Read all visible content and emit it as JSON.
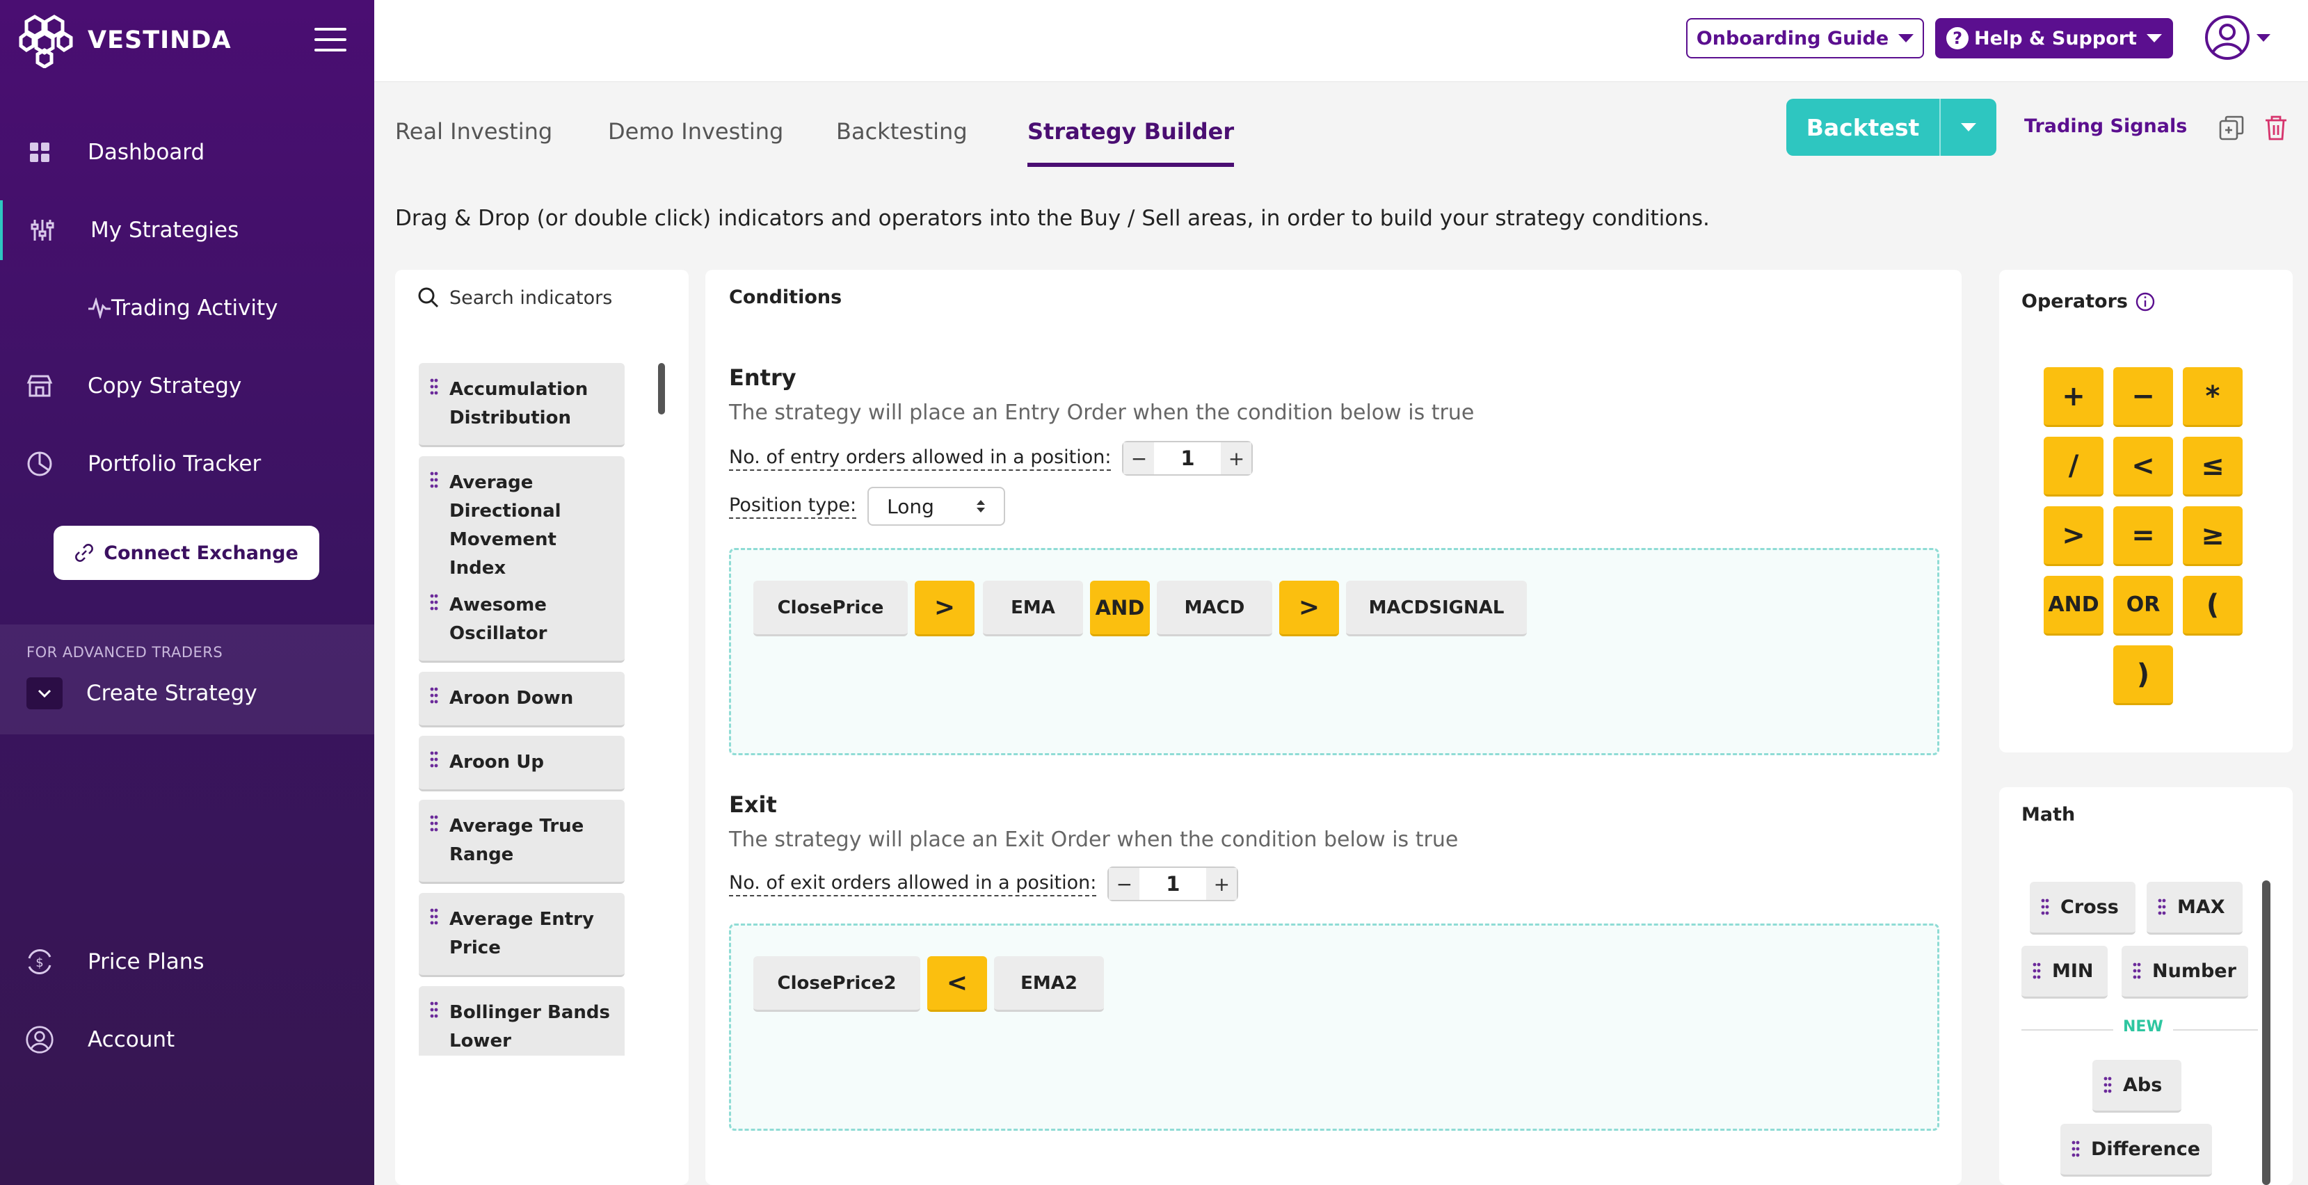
{
  "brand": {
    "name": "VESTINDA"
  },
  "sidebar": {
    "items": [
      {
        "label": "Dashboard",
        "icon": "grid-icon"
      },
      {
        "label": "My Strategies",
        "icon": "sliders-icon"
      },
      {
        "label": "Trading Activity",
        "icon": "pulse-icon"
      },
      {
        "label": "Copy Strategy",
        "icon": "store-icon"
      },
      {
        "label": "Portfolio Tracker",
        "icon": "pie-chart-icon"
      },
      {
        "label": "Price Plans",
        "icon": "dollar-cycle-icon"
      },
      {
        "label": "Account",
        "icon": "user-circle-icon"
      }
    ],
    "connect_label": "Connect Exchange",
    "advanced_label": "FOR ADVANCED TRADERS",
    "create_label": "Create Strategy",
    "accent": "#2ec6c0"
  },
  "topbar": {
    "onboarding_label": "Onboarding Guide",
    "help_label": "Help & Support"
  },
  "tabs": [
    {
      "label": "Real Investing"
    },
    {
      "label": "Demo Investing"
    },
    {
      "label": "Backtesting"
    },
    {
      "label": "Strategy Builder",
      "active": true
    }
  ],
  "actions": {
    "backtest_label": "Backtest",
    "signals_label": "Trading Signals"
  },
  "instruction": "Drag & Drop (or double click) indicators and operators into the Buy / Sell areas, in order to build your strategy conditions.",
  "indicators": {
    "search_placeholder": "Search indicators",
    "items": [
      "Accumulation Distribution",
      "Average Directional Movement Index",
      "Awesome Oscillator",
      "Aroon Down",
      "Aroon Up",
      "Average True Range",
      "Average Entry Price",
      "Bollinger Bands Lower"
    ]
  },
  "conditions": {
    "title": "Conditions",
    "entry": {
      "title": "Entry",
      "description": "The strategy will place an Entry Order when the condition below is true",
      "orders_label": "No. of entry orders allowed in a position:",
      "orders_value": "1",
      "position_label": "Position type:",
      "position_value": "Long",
      "tokens": [
        "ClosePrice",
        ">",
        "EMA",
        "AND",
        "MACD",
        ">",
        "MACDSIGNAL"
      ]
    },
    "exit": {
      "title": "Exit",
      "description": "The strategy will place an Exit Order when the condition below is true",
      "orders_label": "No. of exit orders allowed in a position:",
      "orders_value": "1",
      "tokens": [
        "ClosePrice2",
        "<",
        "EMA2"
      ]
    }
  },
  "operators": {
    "title": "Operators",
    "items": [
      "+",
      "−",
      "*",
      "/",
      "<",
      "≤",
      ">",
      "=",
      "≥",
      "AND",
      "OR",
      "(",
      ")"
    ]
  },
  "math": {
    "title": "Math",
    "items": [
      "Cross",
      "MAX",
      "MIN",
      "Number"
    ],
    "new_label": "NEW",
    "new_items": [
      "Abs",
      "Difference"
    ]
  },
  "colors": {
    "sidebar_bg": "#4a0e72",
    "brand_purple": "#5b0f8f",
    "teal": "#2ec6c0",
    "operator_yellow": "#fbbf0f"
  }
}
